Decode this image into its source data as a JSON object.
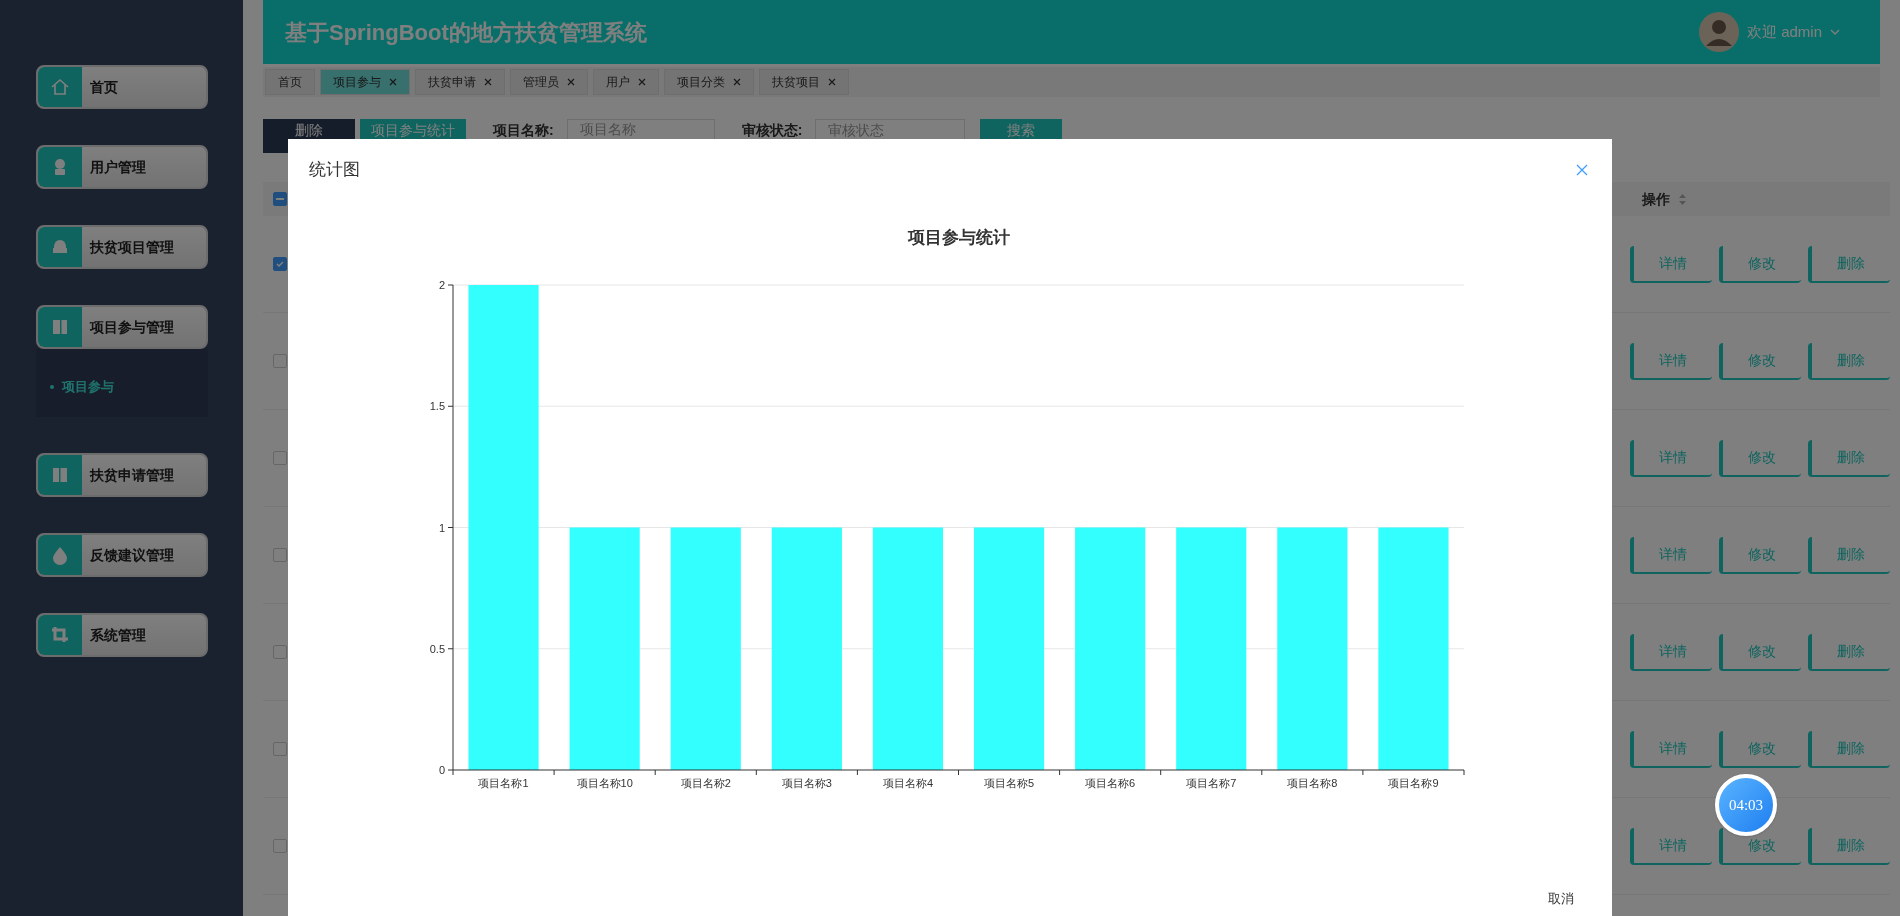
{
  "header": {
    "title": "基于SpringBoot的地方扶贫管理系统",
    "greeting": "欢迎 admin"
  },
  "sidebar": {
    "items": [
      {
        "label": "首页"
      },
      {
        "label": "用户管理"
      },
      {
        "label": "扶贫项目管理"
      },
      {
        "label": "项目参与管理",
        "expanded": true,
        "children": [
          {
            "label": "项目参与",
            "selected": true
          }
        ]
      },
      {
        "label": "扶贫申请管理"
      },
      {
        "label": "反馈建议管理"
      },
      {
        "label": "系统管理"
      }
    ]
  },
  "tabs": [
    {
      "label": "首页",
      "selected": false,
      "closable": false
    },
    {
      "label": "项目参与",
      "selected": true,
      "closable": true
    },
    {
      "label": "扶贫申请",
      "selected": false,
      "closable": true
    },
    {
      "label": "管理员",
      "selected": false,
      "closable": true
    },
    {
      "label": "用户",
      "selected": false,
      "closable": true
    },
    {
      "label": "项目分类",
      "selected": false,
      "closable": true
    },
    {
      "label": "扶贫项目",
      "selected": false,
      "closable": true
    }
  ],
  "toolbar": {
    "buttons": [
      {
        "label": "删除",
        "kind": "dark"
      },
      {
        "label": "项目参与统计",
        "kind": "teal"
      }
    ],
    "filters": [
      {
        "label": "项目名称:",
        "placeholder": "项目名称",
        "kind": "input"
      },
      {
        "label": "审核状态:",
        "placeholder": "审核状态",
        "kind": "select"
      }
    ],
    "search": "搜索"
  },
  "table": {
    "select_all": {
      "indeterminate": true
    },
    "columns": [
      {
        "label": "操作"
      }
    ],
    "rows": [
      {
        "selected": true,
        "actions": [
          "详情",
          "修改",
          "删除"
        ]
      },
      {
        "selected": false,
        "actions": [
          "详情",
          "修改",
          "删除"
        ]
      },
      {
        "selected": false,
        "actions": [
          "详情",
          "修改",
          "删除"
        ]
      },
      {
        "selected": false,
        "actions": [
          "详情",
          "修改",
          "删除"
        ]
      },
      {
        "selected": false,
        "actions": [
          "详情",
          "修改",
          "删除"
        ]
      },
      {
        "selected": false,
        "actions": [
          "详情",
          "修改",
          "删除"
        ]
      },
      {
        "selected": false,
        "actions": [
          "详情",
          "修改",
          "删除"
        ]
      }
    ]
  },
  "modal": {
    "title": "统计图",
    "chart_data": {
      "type": "bar",
      "title": "项目参与统计",
      "categories": [
        "项目名称1",
        "项目名称10",
        "项目名称2",
        "项目名称3",
        "项目名称4",
        "项目名称5",
        "项目名称6",
        "项目名称7",
        "项目名称8",
        "项目名称9"
      ],
      "values": [
        2,
        1,
        1,
        1,
        1,
        1,
        1,
        1,
        1,
        1
      ],
      "grid": true,
      "ylim": [
        0,
        2
      ],
      "yticks": [
        0,
        {
          "value": 0.5,
          "label": "0.5"
        },
        1,
        {
          "value": 1.5,
          "label": "1.5"
        },
        2
      ]
    },
    "buttons": [
      "取消"
    ]
  },
  "timer": "04:03"
}
